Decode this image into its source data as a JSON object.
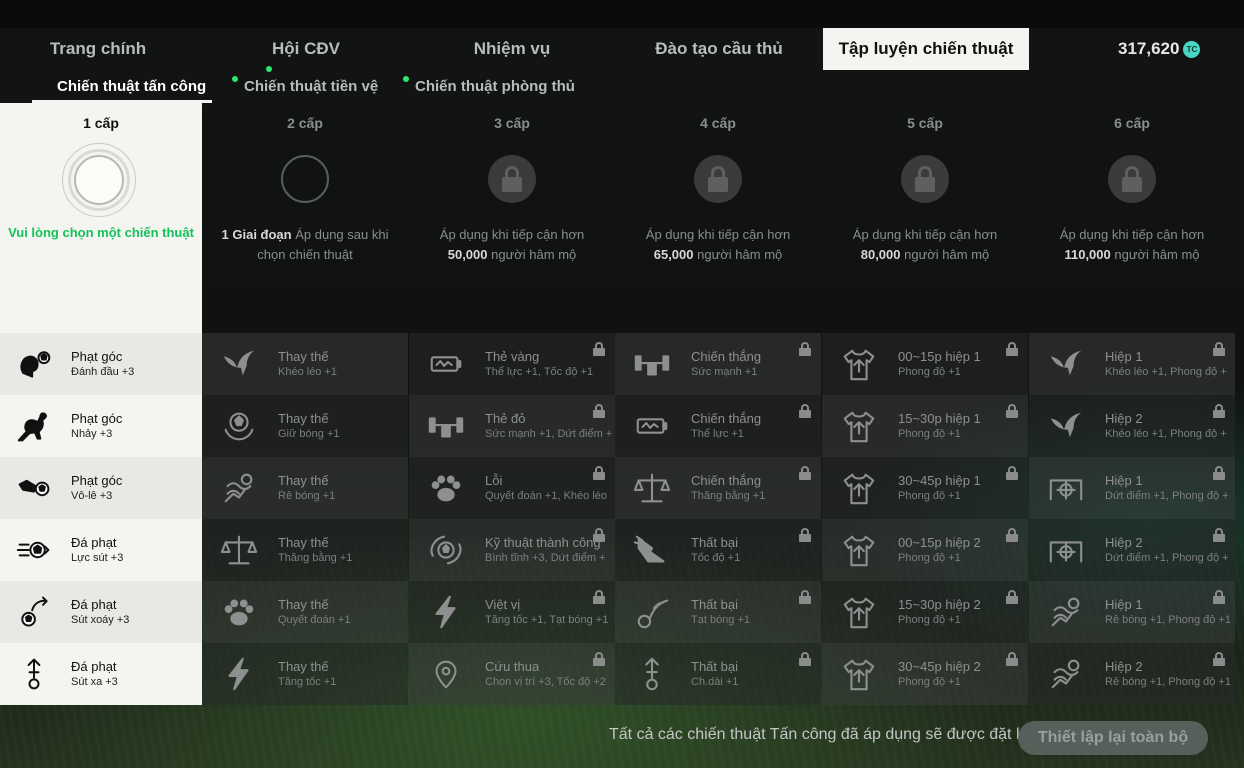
{
  "main_tabs": [
    {
      "label": "Trang chính",
      "dot": false,
      "active": false
    },
    {
      "label": "Hội CĐV",
      "dot": true,
      "active": false
    },
    {
      "label": "Nhiệm vụ",
      "dot": false,
      "active": false
    },
    {
      "label": "Đào tạo cầu thủ",
      "dot": false,
      "active": false
    },
    {
      "label": "Tập luyện chiến thuật",
      "dot": false,
      "active": true
    }
  ],
  "coins": {
    "value": "317,620",
    "icon": "tc-coin-icon",
    "icon_text": "TC"
  },
  "sub_tabs": [
    {
      "label": "Chiến thuật tấn công",
      "dot": false,
      "active": true
    },
    {
      "label": "Chiến thuật tiền vệ",
      "dot": true,
      "active": false
    },
    {
      "label": "Chiến thuật phòng thủ",
      "dot": true,
      "active": false
    }
  ],
  "level1": {
    "label": "1 cấp",
    "prompt": "Vui lòng chọn một chiến thuật"
  },
  "levels": [
    {
      "label": "2 cấp",
      "locked": false,
      "bold": "1 Giai đoạn",
      "line1": " Áp dụng sau khi",
      "line2": "chọn chiến thuật",
      "line2_bold": ""
    },
    {
      "label": "3 cấp",
      "locked": true,
      "bold": "",
      "line1": "Áp dụng khi tiếp cận hơn",
      "line2_bold": "50,000",
      "line2": " người hâm mộ"
    },
    {
      "label": "4 cấp",
      "locked": true,
      "bold": "",
      "line1": "Áp dụng khi tiếp cận hơn",
      "line2_bold": "65,000",
      "line2": " người hâm mộ"
    },
    {
      "label": "5 cấp",
      "locked": true,
      "bold": "",
      "line1": "Áp dụng khi tiếp cận hơn",
      "line2_bold": "80,000",
      "line2": " người hâm mộ"
    },
    {
      "label": "6 cấp",
      "locked": true,
      "bold": "",
      "line1": "Áp dụng khi tiếp cận hơn",
      "line2_bold": "110,000",
      "line2": " người hâm mộ"
    }
  ],
  "left_rows": [
    {
      "title": "Phạt góc",
      "sub": "Đánh đầu +3",
      "icon": "header-ball-icon"
    },
    {
      "title": "Phạt góc",
      "sub": "Nhảy +3",
      "icon": "kangaroo-icon"
    },
    {
      "title": "Phạt góc",
      "sub": "Vô-lê +3",
      "icon": "volley-icon"
    },
    {
      "title": "Đá phạt",
      "sub": "Lực sút +3",
      "icon": "power-shot-icon"
    },
    {
      "title": "Đá phạt",
      "sub": "Sút xoáy +3",
      "icon": "curl-shot-icon"
    },
    {
      "title": "Đá phạt",
      "sub": "Sút xa +3",
      "icon": "long-shot-icon"
    }
  ],
  "grid": [
    [
      {
        "title": "Thay thế",
        "sub": "Khéo léo +1",
        "icon": "bird-icon",
        "locked": false
      },
      {
        "title": "Thẻ vàng",
        "sub": "Thể lực +1, Tốc độ +1",
        "icon": "battery-icon",
        "locked": true
      },
      {
        "title": "Chiến thắng",
        "sub": "Sức mạnh +1",
        "icon": "dumbbell-icon",
        "locked": true
      },
      {
        "title": "00~15p hiệp 1",
        "sub": "Phong độ +1",
        "icon": "jersey-up-icon",
        "locked": true
      },
      {
        "title": "Hiệp 1",
        "sub": "Khéo léo +1, Phong độ +",
        "icon": "bird-icon",
        "locked": true
      }
    ],
    [
      {
        "title": "Thay thế",
        "sub": "Giữ bóng +1",
        "icon": "ball-hands-icon",
        "locked": false
      },
      {
        "title": "Thẻ đỏ",
        "sub": "Sức mạnh +1, Dứt điểm +",
        "icon": "dumbbell-icon",
        "locked": true
      },
      {
        "title": "Chiến thắng",
        "sub": "Thể lực +1",
        "icon": "battery-icon",
        "locked": true
      },
      {
        "title": "15~30p hiệp 1",
        "sub": "Phong độ +1",
        "icon": "jersey-up-icon",
        "locked": true
      },
      {
        "title": "Hiệp 2",
        "sub": "Khéo léo +1, Phong độ +",
        "icon": "bird-icon",
        "locked": true
      }
    ],
    [
      {
        "title": "Thay thế",
        "sub": "Rê bóng +1",
        "icon": "dribble-icon",
        "locked": false
      },
      {
        "title": "Lỗi",
        "sub": "Quyết đoán +1, Khéo léo",
        "icon": "paw-icon",
        "locked": true
      },
      {
        "title": "Chiến thắng",
        "sub": "Thăng bằng +1",
        "icon": "scale-icon",
        "locked": true
      },
      {
        "title": "30~45p hiệp 1",
        "sub": "Phong độ +1",
        "icon": "jersey-up-icon",
        "locked": true
      },
      {
        "title": "Hiệp 1",
        "sub": "Dứt điểm +1, Phong độ +",
        "icon": "goal-target-icon",
        "locked": true
      }
    ],
    [
      {
        "title": "Thay thế",
        "sub": "Thăng bằng +1",
        "icon": "scale-icon",
        "locked": false
      },
      {
        "title": "Kỹ thuật thành công",
        "sub": "Bình tĩnh +3, Dứt điểm +",
        "icon": "ball-spin-icon",
        "locked": true
      },
      {
        "title": "Thất bại",
        "sub": "Tốc độ +1",
        "icon": "winged-boot-icon",
        "locked": true
      },
      {
        "title": "00~15p hiệp 2",
        "sub": "Phong độ +1",
        "icon": "jersey-up-icon",
        "locked": true
      },
      {
        "title": "Hiệp 2",
        "sub": "Dứt điểm +1, Phong độ +",
        "icon": "goal-target-icon",
        "locked": true
      }
    ],
    [
      {
        "title": "Thay thế",
        "sub": "Quyết đoán +1",
        "icon": "paw-icon",
        "locked": false
      },
      {
        "title": "Việt vị",
        "sub": "Tăng tốc +1, Tạt bóng +1",
        "icon": "lightning-icon",
        "locked": true
      },
      {
        "title": "Thất bại",
        "sub": "Tạt bóng +1",
        "icon": "cross-ball-icon",
        "locked": true
      },
      {
        "title": "15~30p hiệp 2",
        "sub": "Phong độ +1",
        "icon": "jersey-up-icon",
        "locked": true
      },
      {
        "title": "Hiệp 1",
        "sub": "Rê bóng +1, Phong độ +1",
        "icon": "dribble-icon",
        "locked": true
      }
    ],
    [
      {
        "title": "Thay thế",
        "sub": "Tăng tốc +1",
        "icon": "lightning-icon",
        "locked": false
      },
      {
        "title": "Cứu thua",
        "sub": "Chọn vị trí +3, Tốc độ +2",
        "icon": "location-pin-icon",
        "locked": true
      },
      {
        "title": "Thất bại",
        "sub": "Ch.dài +1",
        "icon": "long-shot-icon",
        "locked": true
      },
      {
        "title": "30~45p hiệp 2",
        "sub": "Phong độ +1",
        "icon": "jersey-up-icon",
        "locked": true
      },
      {
        "title": "Hiệp 2",
        "sub": "Rê bóng +1, Phong độ +1",
        "icon": "dribble-icon",
        "locked": true
      }
    ]
  ],
  "footer": {
    "notice": "Tất cả các chiến thuật Tấn công đã áp dụng sẽ được đặt lại.",
    "reset_label": "Thiết lập lại toàn bộ"
  },
  "colors": {
    "accent_green": "#16c15c",
    "notification_dot": "#2ee66e",
    "active_tab_bg": "#f4f4f0",
    "coin": "#49d6c2"
  }
}
